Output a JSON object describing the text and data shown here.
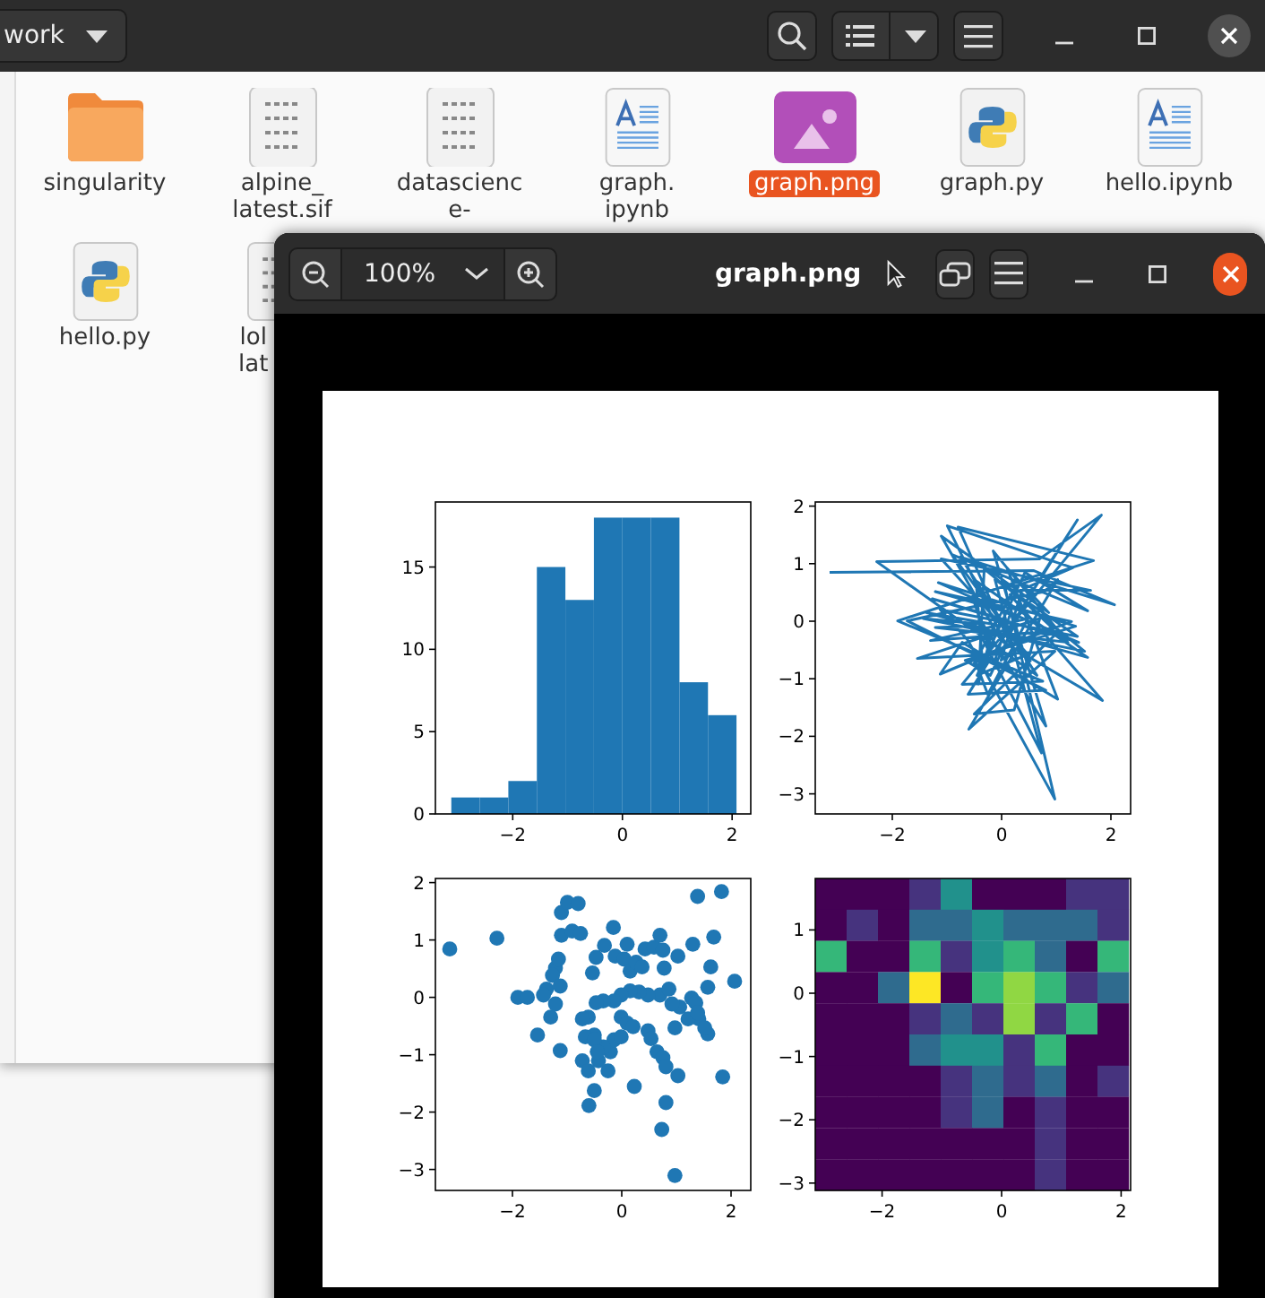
{
  "file_manager": {
    "path": "work",
    "files": [
      {
        "kind": "folder",
        "label_lines": [
          "singularity"
        ],
        "selected": false
      },
      {
        "kind": "binary",
        "label_lines": [
          "alpine_",
          "latest.sif"
        ],
        "selected": false
      },
      {
        "kind": "binary",
        "label_lines": [
          "datascienc",
          "e-"
        ],
        "selected": false
      },
      {
        "kind": "document",
        "label_lines": [
          "graph.",
          "ipynb"
        ],
        "selected": false
      },
      {
        "kind": "image",
        "label_lines": [
          "graph.png"
        ],
        "selected": true
      },
      {
        "kind": "python",
        "label_lines": [
          "graph.py"
        ],
        "selected": false
      },
      {
        "kind": "document",
        "label_lines": [
          "hello.ipynb"
        ],
        "selected": false
      },
      {
        "kind": "python",
        "label_lines": [
          "hello.py"
        ],
        "selected": false
      },
      {
        "kind": "binary",
        "label_lines": [
          "lol",
          "lat"
        ],
        "selected": false
      }
    ]
  },
  "image_viewer": {
    "zoom": "100%",
    "title": "graph.png",
    "plots": [
      {
        "kind": "histogram",
        "chart_data": {
          "type": "bar",
          "x": [
            -2.86,
            -2.34,
            -1.82,
            -1.3,
            -0.78,
            -0.26,
            0.26,
            0.78,
            1.3,
            1.82
          ],
          "series": [
            {
              "color": "#1f77b4",
              "values": [
                1,
                1,
                2,
                15,
                13,
                18,
                18,
                18,
                8,
                6
              ]
            }
          ],
          "xlim": [
            -3.41,
            2.34
          ],
          "ylim": [
            0,
            18.95
          ],
          "xticks": [
            {
              "value": -2,
              "label": "−2"
            },
            {
              "value": 0,
              "label": "0"
            },
            {
              "value": 2,
              "label": "2"
            }
          ],
          "yticks": [
            {
              "value": 0,
              "label": "0"
            },
            {
              "value": 5,
              "label": "5"
            },
            {
              "value": 10,
              "label": "10"
            },
            {
              "value": 15,
              "label": "15"
            }
          ]
        }
      },
      {
        "kind": "line",
        "x_ticks": [
          "−2",
          "0",
          "2"
        ],
        "y_ticks": [
          "2",
          "1",
          "0",
          "−1",
          "−2",
          "−3"
        ]
      },
      {
        "kind": "scatter",
        "x_ticks": [
          "−2",
          "0",
          "2"
        ],
        "y_ticks": [
          "2",
          "1",
          "0",
          "−1",
          "−2",
          "−3"
        ]
      },
      {
        "kind": "heatmap",
        "x_ticks": [
          "−2",
          "0",
          "2"
        ],
        "y_ticks": [
          "1",
          "0",
          "−1",
          "−2",
          "−3"
        ]
      }
    ]
  }
}
